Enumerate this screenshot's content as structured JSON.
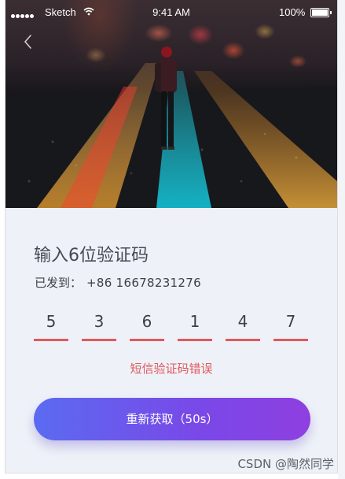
{
  "status_bar": {
    "carrier": "Sketch",
    "time": "9:41 AM",
    "battery": "100%"
  },
  "verify": {
    "title": "输入6位验证码",
    "sent_label": "已发到：",
    "phone_number": "+86 16678231276",
    "code_digits": [
      "5",
      "3",
      "6",
      "1",
      "4",
      "7"
    ],
    "error_text": "短信验证码错误",
    "resend_button": "重新获取（50s）"
  },
  "watermark": "CSDN @陶然同学",
  "colors": {
    "error_red": "#e0585a",
    "underline_red": "#e05a5a",
    "button_gradient_start": "#5a6bf0",
    "button_gradient_end": "#8f3fe0",
    "background": "#eef2f8"
  },
  "icons": {
    "back": "chevron-left-icon",
    "wifi": "wifi-icon",
    "battery": "battery-icon"
  }
}
